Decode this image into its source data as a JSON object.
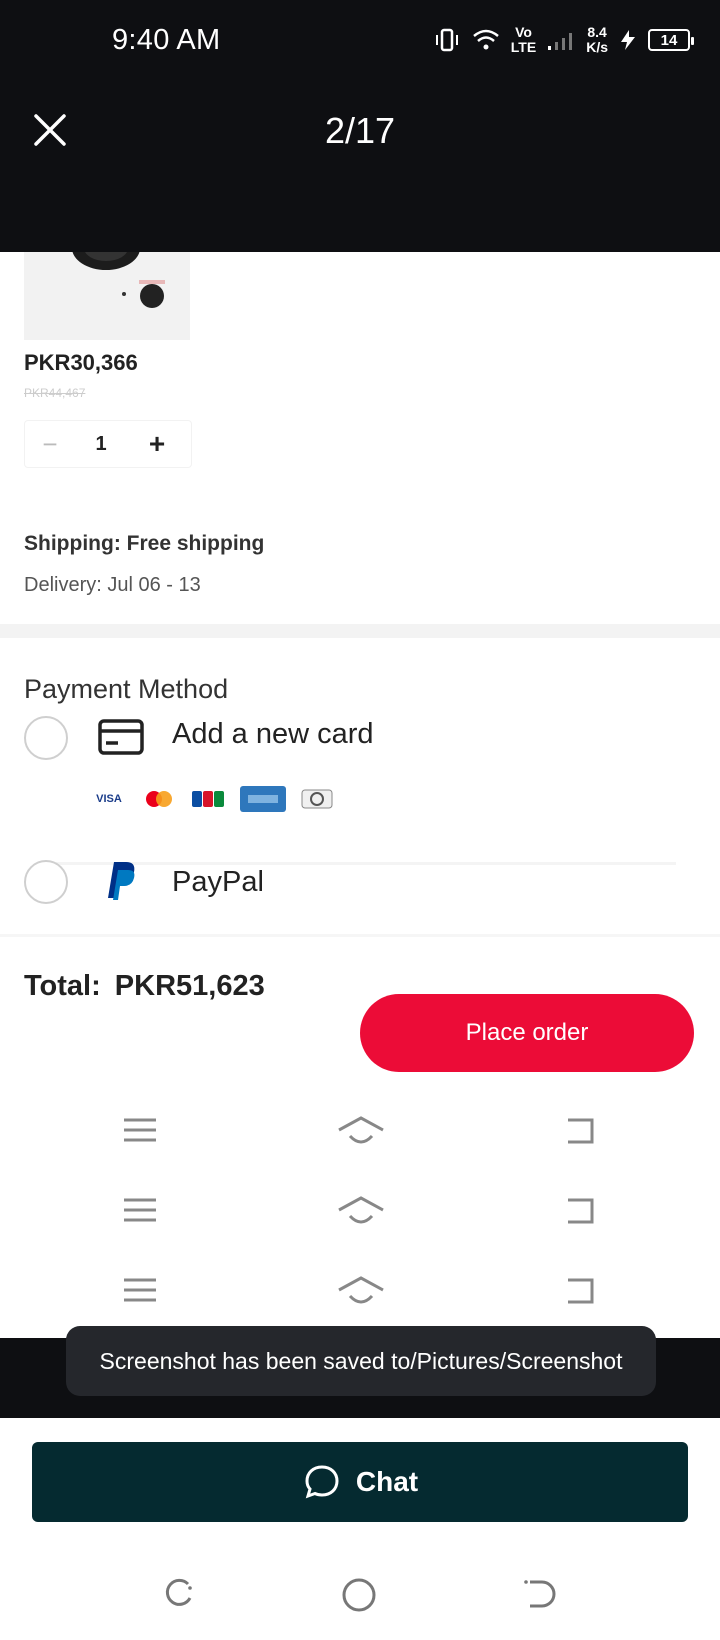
{
  "status_bar": {
    "time": "9:40 AM",
    "volte_top": "Vo",
    "volte_bottom": "LTE",
    "speed_value": "8.4",
    "speed_unit": "K/s",
    "battery": "14"
  },
  "viewer": {
    "counter": "2/17"
  },
  "product": {
    "price": "PKR30,366",
    "old_price": "PKR44,467",
    "quantity": "1",
    "minus": "−",
    "plus": "+"
  },
  "shipping": {
    "shipping_text": "Shipping: Free shipping",
    "delivery_text": "Delivery: Jul 06 - 13"
  },
  "payment": {
    "title": "Payment Method",
    "options": [
      {
        "label": "Add a new card"
      },
      {
        "label": "PayPal"
      }
    ],
    "brands": [
      "VISA",
      "mastercard",
      "JCB",
      "AMEX",
      "Diners"
    ]
  },
  "order": {
    "total_label": "Total:",
    "total_value": "PKR51,623",
    "place_order": "Place order"
  },
  "toast": {
    "message": "Screenshot has been saved to/Pictures/Screenshot"
  },
  "chat": {
    "label": "Chat"
  },
  "colors": {
    "accent_red": "#ec0c37",
    "chat_bg": "#052a30",
    "dark_bar": "#0e0f12"
  }
}
